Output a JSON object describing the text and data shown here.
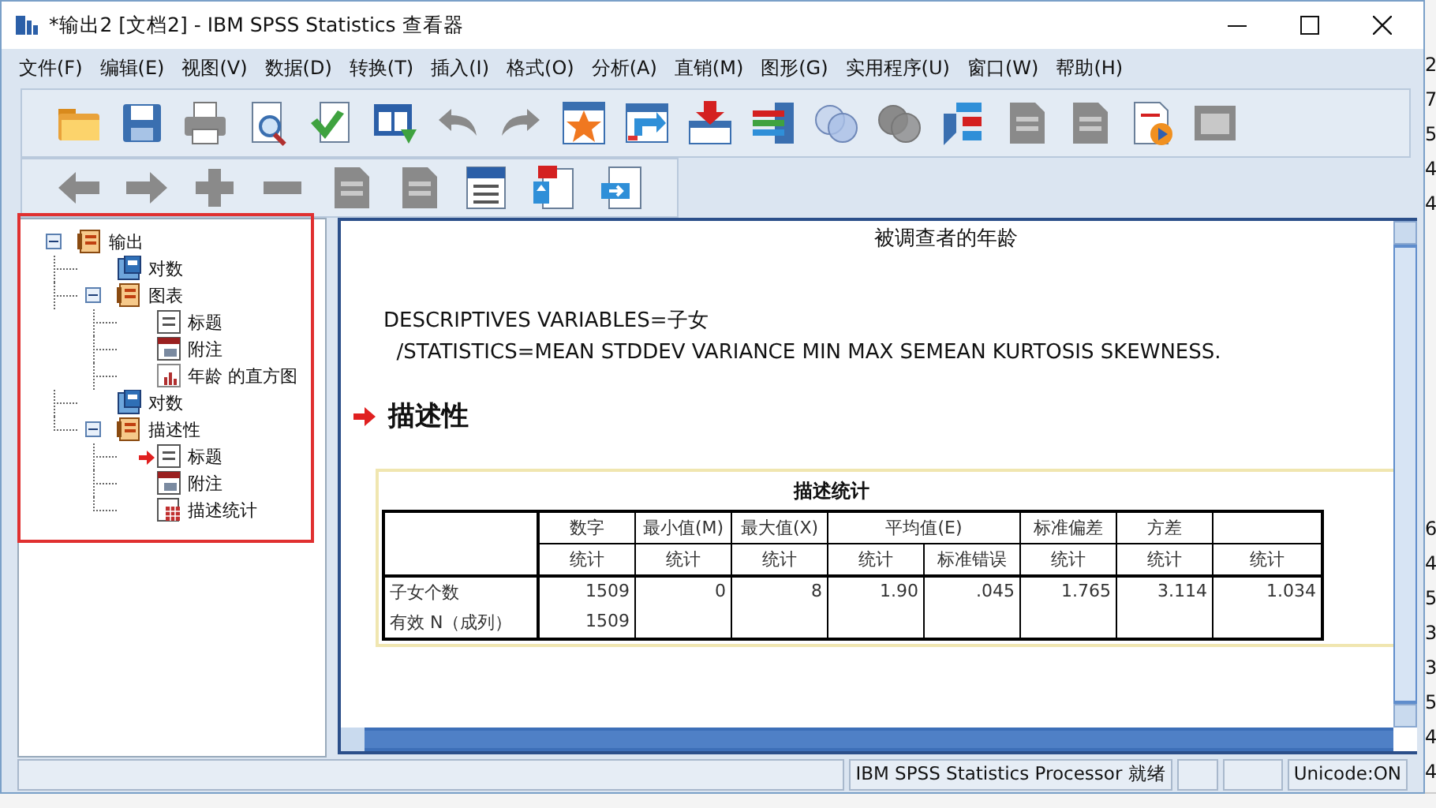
{
  "window": {
    "title": "*输出2 [文档2] - IBM SPSS Statistics 查看器"
  },
  "menu": [
    "文件(F)",
    "编辑(E)",
    "视图(V)",
    "数据(D)",
    "转换(T)",
    "插入(I)",
    "格式(O)",
    "分析(A)",
    "直销(M)",
    "图形(G)",
    "实用程序(U)",
    "窗口(W)",
    "帮助(H)"
  ],
  "toolbars": [
    [
      {
        "kind": "open",
        "disabled": false
      },
      {
        "kind": "save",
        "disabled": false
      },
      {
        "kind": "print",
        "disabled": false
      },
      {
        "kind": "preview",
        "disabled": false
      },
      {
        "kind": "export",
        "disabled": false
      },
      {
        "kind": "dialog",
        "disabled": false
      },
      {
        "kind": "undo",
        "disabled": true
      },
      {
        "kind": "redo",
        "disabled": true
      },
      {
        "kind": "star",
        "disabled": false
      },
      {
        "kind": "grid-arrow",
        "disabled": false
      },
      {
        "kind": "insert",
        "disabled": false
      },
      {
        "kind": "bars",
        "disabled": false
      },
      {
        "kind": "circles",
        "disabled": false
      },
      {
        "kind": "circles",
        "disabled": true
      },
      {
        "kind": "tree",
        "disabled": false
      },
      {
        "kind": "doc",
        "disabled": true
      },
      {
        "kind": "doc",
        "disabled": true
      },
      {
        "kind": "media",
        "disabled": false
      },
      {
        "kind": "window",
        "disabled": true
      }
    ],
    [
      {
        "kind": "back",
        "disabled": true
      },
      {
        "kind": "forward",
        "disabled": true
      },
      {
        "kind": "expand",
        "disabled": true
      },
      {
        "kind": "collapse",
        "disabled": true
      },
      {
        "kind": "doc",
        "disabled": true
      },
      {
        "kind": "doc",
        "disabled": true
      },
      {
        "kind": "heading",
        "disabled": false
      },
      {
        "kind": "page",
        "disabled": false
      },
      {
        "kind": "page-arrow",
        "disabled": false
      }
    ]
  ],
  "tree": [
    {
      "label": "输出",
      "kind": "book",
      "expanded": true,
      "current": false,
      "children": [
        {
          "label": "对数",
          "kind": "log",
          "current": false
        },
        {
          "label": "图表",
          "kind": "book",
          "expanded": true,
          "current": false,
          "children": [
            {
              "label": "标题",
              "kind": "title",
              "current": false
            },
            {
              "label": "附注",
              "kind": "notes",
              "current": false
            },
            {
              "label": "年龄 的直方图",
              "kind": "chart",
              "current": false
            }
          ]
        },
        {
          "label": "对数",
          "kind": "log",
          "current": false
        },
        {
          "label": "描述性",
          "kind": "book",
          "expanded": true,
          "current": false,
          "children": [
            {
              "label": "标题",
              "kind": "title",
              "current": true
            },
            {
              "label": "附注",
              "kind": "notes",
              "current": false
            },
            {
              "label": "描述统计",
              "kind": "table",
              "current": false
            }
          ]
        }
      ]
    }
  ],
  "output": {
    "prev_title": "被调查者的年龄",
    "syntax": [
      "DESCRIPTIVES VARIABLES=子女",
      "  /STATISTICS=MEAN STDDEV VARIANCE MIN MAX SEMEAN KURTOSIS SKEWNESS."
    ],
    "heading": "描述性",
    "table": {
      "title": "描述统计",
      "groups": [
        {
          "label": "数字",
          "subheaders": [
            "统计"
          ]
        },
        {
          "label": "最小值(M)",
          "subheaders": [
            "统计"
          ]
        },
        {
          "label": "最大值(X)",
          "subheaders": [
            "统计"
          ]
        },
        {
          "label": "平均值(E)",
          "subheaders": [
            "统计",
            "标准错误"
          ]
        },
        {
          "label": "标准偏差",
          "subheaders": [
            "统计"
          ]
        },
        {
          "label": "方差",
          "subheaders": [
            "统计"
          ]
        },
        {
          "subheaders": [
            "统计"
          ]
        }
      ],
      "rows": [
        {
          "label": "子女个数",
          "cells": [
            "1509",
            "0",
            "8",
            "1.90",
            ".045",
            "1.765",
            "3.114",
            "1.034"
          ]
        },
        {
          "label": "有效 N（成列）",
          "cells": [
            "1509"
          ]
        }
      ]
    }
  },
  "status_bar": {
    "processor": "IBM SPSS Statistics Processor 就绪",
    "encoding": "Unicode:ON"
  },
  "background_sheet": {
    "top_values": [
      "2",
      "7",
      "5",
      "4",
      "4"
    ],
    "bottom_values": [
      "6",
      "4",
      "5",
      "3",
      "3",
      "5",
      "4",
      "4"
    ]
  }
}
